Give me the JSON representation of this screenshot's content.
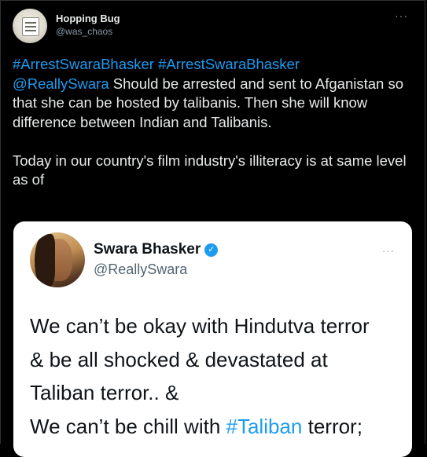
{
  "author": {
    "display_name": "Hopping Bug",
    "handle": "@was_chaos",
    "avatar_icon": "mug-avatar-icon"
  },
  "more_label": "···",
  "tweet": {
    "hashtag1": "#ArrestSwaraBhasker",
    "hashtag2": "#ArrestSwaraBhasker",
    "mention": "@ReallySwara",
    "text_part1": " Should be arrested and sent to Afganistan so that she can be hosted by talibanis. Then she will know difference between Indian and Talibanis.",
    "text_part2": "Today in our country's film industry's illiteracy is at same level as of"
  },
  "embedded_tweet": {
    "display_name": "Swara Bhasker",
    "verified_label": "✓",
    "handle": "@ReallySwara",
    "more_label": "···",
    "line1": "We can’t be okay with Hindutva terror",
    "line2": "& be all shocked & devastated at",
    "line3": "Taliban terror.. &",
    "line4_pre": "We can’t be chill with ",
    "line4_hashtag": "#Taliban",
    "line4_post": " terror;"
  },
  "colors": {
    "background": "#000000",
    "text": "#e7e9ea",
    "secondary_text": "#8b98a5",
    "link": "#1d9bf0",
    "card_background": "#ffffff",
    "card_text": "#0f1419"
  }
}
